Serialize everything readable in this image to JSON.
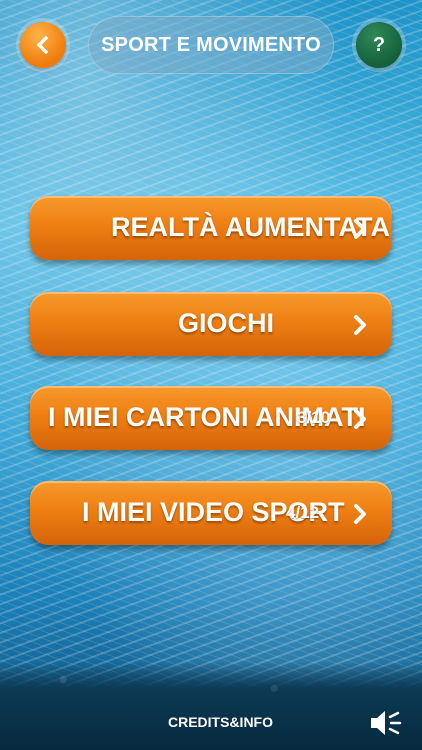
{
  "header": {
    "back_icon": "chevron-left-icon",
    "title": "SPORT E MOVIMENTO",
    "help_label": "?"
  },
  "menu": [
    {
      "label": "REALTÀ AUMENTATA",
      "count": ""
    },
    {
      "label": "GIOCHI",
      "count": ""
    },
    {
      "label": "I MIEI CARTONI ANIMATI",
      "count": "3/10"
    },
    {
      "label": "I MIEI VIDEO SPORT",
      "count": "4/12"
    }
  ],
  "footer": {
    "credits_label": "CREDITS&INFO",
    "sound_icon": "speaker-icon"
  },
  "colors": {
    "accent": "#ef7f12",
    "help_button": "#155f3a"
  }
}
